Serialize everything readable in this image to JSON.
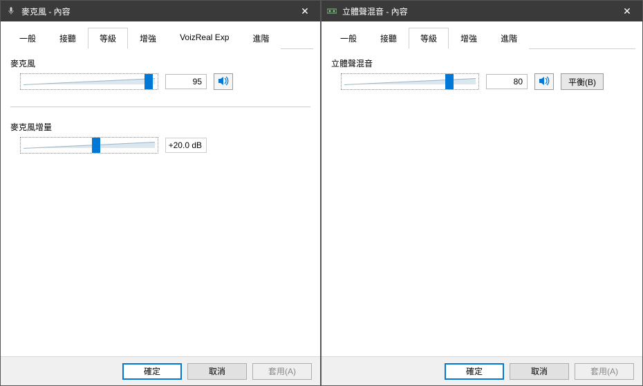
{
  "left": {
    "title": "麥克風 - 內容",
    "tabs": [
      "一般",
      "接聽",
      "等級",
      "增強",
      "VoizReal Exp",
      "進階"
    ],
    "activeTab": 2,
    "mic": {
      "label": "麥克風",
      "value": "95",
      "percent": 95
    },
    "gain": {
      "label": "麥克風增量",
      "value": "+20.0 dB",
      "percent": 55
    },
    "buttons": {
      "ok": "確定",
      "cancel": "取消",
      "apply": "套用(A)"
    }
  },
  "right": {
    "title": "立體聲混音 - 內容",
    "tabs": [
      "一般",
      "接聽",
      "等級",
      "增強",
      "進階"
    ],
    "activeTab": 2,
    "mix": {
      "label": "立體聲混音",
      "value": "80",
      "percent": 80
    },
    "balanceLabel": "平衡(B)",
    "buttons": {
      "ok": "確定",
      "cancel": "取消",
      "apply": "套用(A)"
    }
  }
}
